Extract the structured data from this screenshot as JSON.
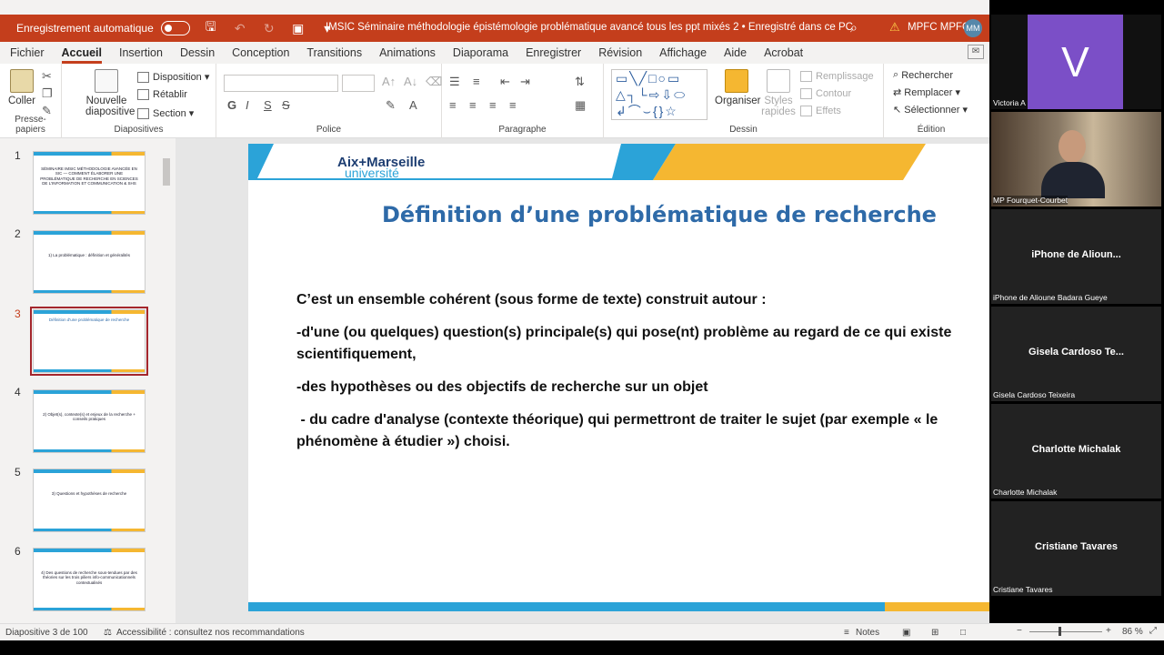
{
  "titlebar": {
    "autosave_label": "Enregistrement automatique",
    "doc_title": "IMSIC Séminaire  méthodologie épistémologie problématique  avancé tous les ppt mixés 2 • Enregistré dans ce PC",
    "user": "MPFC MPFC",
    "user_initials": "MM"
  },
  "menu": [
    "Fichier",
    "Accueil",
    "Insertion",
    "Dessin",
    "Conception",
    "Transitions",
    "Animations",
    "Diaporama",
    "Enregistrer",
    "Révision",
    "Affichage",
    "Aide",
    "Acrobat"
  ],
  "menu_active_index": 1,
  "ribbon": {
    "clipboard": {
      "paste_label": "Coller",
      "group_label": "Presse-papiers"
    },
    "slides": {
      "new_label_1": "Nouvelle",
      "new_label_2": "diapositive",
      "layout": "Disposition",
      "reset": "Rétablir",
      "section": "Section",
      "group_label": "Diapositives"
    },
    "font": {
      "group_label": "Police"
    },
    "paragraph": {
      "group_label": "Paragraphe"
    },
    "drawing": {
      "arrange": "Organiser",
      "styles_1": "Styles",
      "styles_2": "rapides",
      "fill": "Remplissage",
      "outline": "Contour",
      "effects": "Effets",
      "group_label": "Dessin"
    },
    "editing": {
      "find": "Rechercher",
      "replace": "Remplacer",
      "select": "Sélectionner",
      "group_label": "Édition"
    }
  },
  "thumbnails": [
    {
      "num": "1",
      "text": "SÉMINAIRE IMSIC MÉTHODOLOGIE AVANCÉE EN SIC — COMMENT ÉLABORER UNE PROBLÉMATIQUE DE RECHERCHE EN SCIENCES DE L'INFORMATION ET COMMUNICATION & SHS"
    },
    {
      "num": "2",
      "text": "1) La problématique : définition et généralités"
    },
    {
      "num": "3",
      "text": "Définition d'une problématique de recherche"
    },
    {
      "num": "4",
      "text": "2) Objet(s), contexte(s) et enjeux de la recherche + conseils pratiques"
    },
    {
      "num": "5",
      "text": "3) Questions et hypothèses de recherche"
    },
    {
      "num": "6",
      "text": "4) Des questions de recherche sous-tendues par des théories sur les trois piliers info-communicationnels contextualisés"
    }
  ],
  "selected_thumbnail_index": 2,
  "slide": {
    "logo_line1": "Aix+Marseille",
    "logo_line2": "université",
    "title": "Définition d’une problématique de recherche",
    "paragraphs": [
      "C’est un ensemble cohérent (sous forme de texte) construit autour :",
      "-d'une (ou quelques) question(s) principale(s) qui pose(nt) problème au regard de ce qui existe scientifiquement,",
      "-des hypothèses ou des objectifs de recherche sur un objet",
      " - du cadre d'analyse (contexte théorique) qui permettront de traiter le sujet (par exemple « le phénomène à étudier ») choisi."
    ]
  },
  "statusbar": {
    "slide_info": "Diapositive 3 de 100",
    "accessibility": "Accessibilité : consultez nos recommandations",
    "notes": "Notes",
    "zoom": "86 %"
  },
  "participants": [
    {
      "name": "Victoria A",
      "display": "V",
      "kind": "avatar"
    },
    {
      "name": "MP Fourquet-Courbet",
      "display": "",
      "kind": "video"
    },
    {
      "name": "iPhone de Alioune Badara Gueye",
      "display": "iPhone de Alioun...",
      "kind": "text"
    },
    {
      "name": "Gisela Cardoso Teixeira",
      "display": "Gisela Cardoso Te...",
      "kind": "text"
    },
    {
      "name": "Charlotte Michalak",
      "display": "Charlotte Michalak",
      "kind": "text"
    },
    {
      "name": "Cristiane Tavares",
      "display": "Cristiane Tavares",
      "kind": "text"
    }
  ],
  "colors": {
    "accent": "#c43e1c",
    "slide_title": "#2e6aa8",
    "brand_blue": "#2ba3d8",
    "brand_yellow": "#f5b731"
  }
}
